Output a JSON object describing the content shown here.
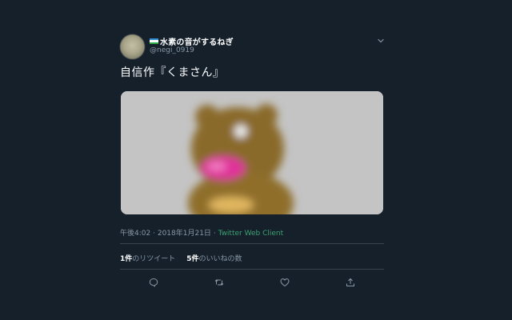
{
  "user": {
    "display_name": "水素の音がするねぎ",
    "handle": "@negi_0919",
    "flag_colors": [
      "#2e8fd8",
      "#ffffff",
      "#2bae4a"
    ]
  },
  "tweet": {
    "text": "自信作『くまさん』",
    "media_alt": "くまさん",
    "time": "午後4:02",
    "date": "2018年1月21日",
    "separator": "·",
    "client": "Twitter Web Client"
  },
  "stats": {
    "retweets_count": "1件",
    "retweets_label": "のリツイート",
    "likes_count": "5件",
    "likes_label": "のいいねの数"
  },
  "icons": {
    "menu": "chevron-down-icon",
    "reply": "reply-icon",
    "retweet": "retweet-icon",
    "like": "like-icon",
    "share": "share-icon"
  },
  "colors": {
    "background": "#15202b",
    "text": "#ffffff",
    "muted": "#8899a6",
    "divider": "#38444d",
    "client_link": "#3ba371"
  }
}
